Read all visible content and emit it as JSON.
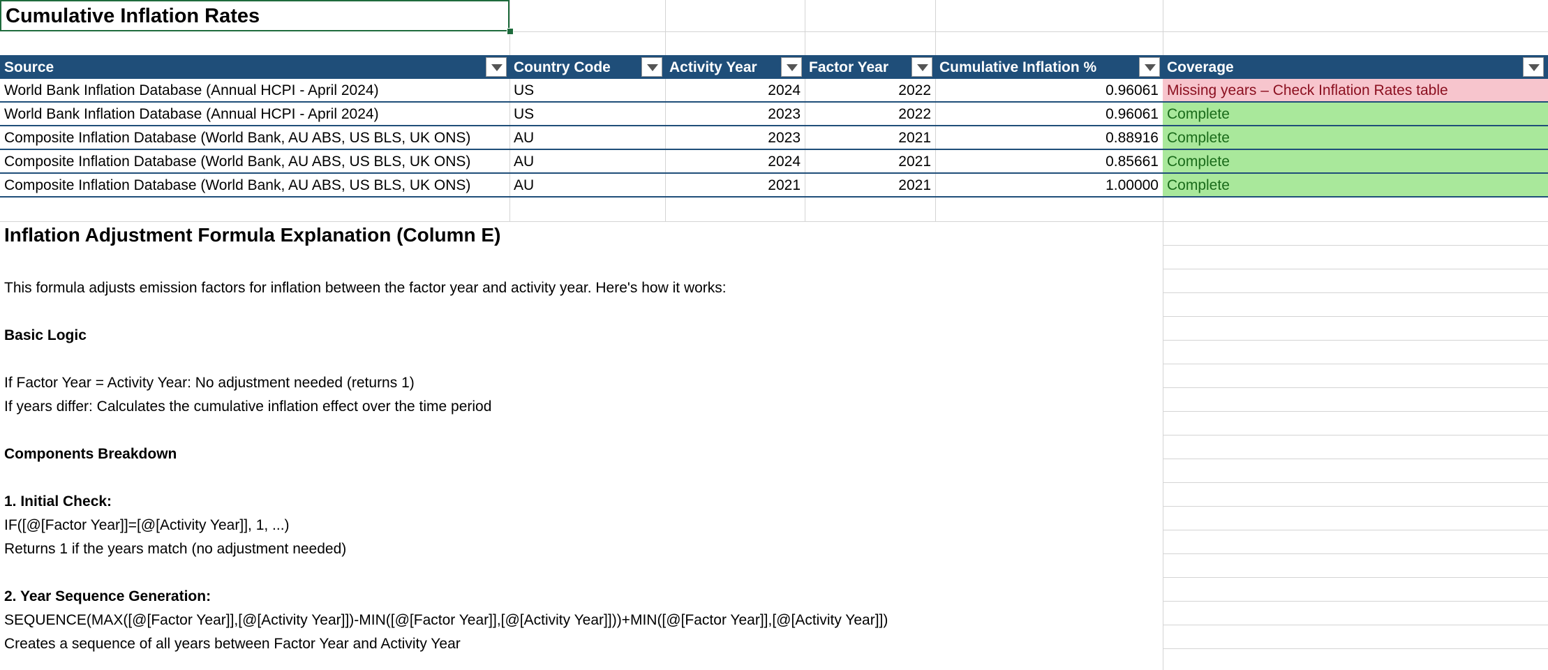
{
  "sheet": {
    "title": "Cumulative Inflation Rates",
    "columns": [
      "Source",
      "Country Code",
      "Activity Year",
      "Factor Year",
      "Cumulative Inflation %",
      "Coverage"
    ],
    "rows": [
      {
        "source": "World Bank Inflation Database (Annual HCPI - April 2024)",
        "country": "US",
        "activity_year": "2024",
        "factor_year": "2022",
        "cumulative": "0.96061",
        "coverage": "Missing years – Check Inflation Rates table",
        "status": "missing"
      },
      {
        "source": "World Bank Inflation Database (Annual HCPI - April 2024)",
        "country": "US",
        "activity_year": "2023",
        "factor_year": "2022",
        "cumulative": "0.96061",
        "coverage": "Complete",
        "status": "complete"
      },
      {
        "source": "Composite Inflation Database (World Bank, AU ABS, US BLS, UK ONS)",
        "country": "AU",
        "activity_year": "2023",
        "factor_year": "2021",
        "cumulative": "0.88916",
        "coverage": "Complete",
        "status": "complete"
      },
      {
        "source": "Composite Inflation Database (World Bank, AU ABS, US BLS, UK ONS)",
        "country": "AU",
        "activity_year": "2024",
        "factor_year": "2021",
        "cumulative": "0.85661",
        "coverage": "Complete",
        "status": "complete"
      },
      {
        "source": "Composite Inflation Database (World Bank, AU ABS, US BLS, UK ONS)",
        "country": "AU",
        "activity_year": "2021",
        "factor_year": "2021",
        "cumulative": "1.00000",
        "coverage": "Complete",
        "status": "complete"
      }
    ],
    "colors": {
      "header_bg": "#1f4e79",
      "missing_bg": "#f7c5cd",
      "complete_bg": "#a9e89b"
    }
  },
  "explanation": {
    "heading": "Inflation Adjustment Formula Explanation (Column E)",
    "intro": "This formula adjusts emission factors for inflation between the factor year and activity year. Here's how it works:",
    "basic_logic_heading": "Basic Logic",
    "basic_logic_1": "If Factor Year = Activity Year: No adjustment needed (returns 1)",
    "basic_logic_2": "If years differ: Calculates the cumulative inflation effect over the time period",
    "components_heading": "Components Breakdown",
    "step1_heading": "1. Initial Check:",
    "step1_formula": "IF([@[Factor Year]]=[@[Activity Year]], 1, ...)",
    "step1_desc": "Returns 1 if the years match (no adjustment needed)",
    "step2_heading": "2. Year Sequence Generation:",
    "step2_formula": "SEQUENCE(MAX([@[Factor Year]],[@[Activity Year]])-MIN([@[Factor Year]],[@[Activity Year]]))+MIN([@[Factor Year]],[@[Activity Year]])",
    "step2_desc": "Creates a sequence of all years between Factor Year and Activity Year"
  }
}
